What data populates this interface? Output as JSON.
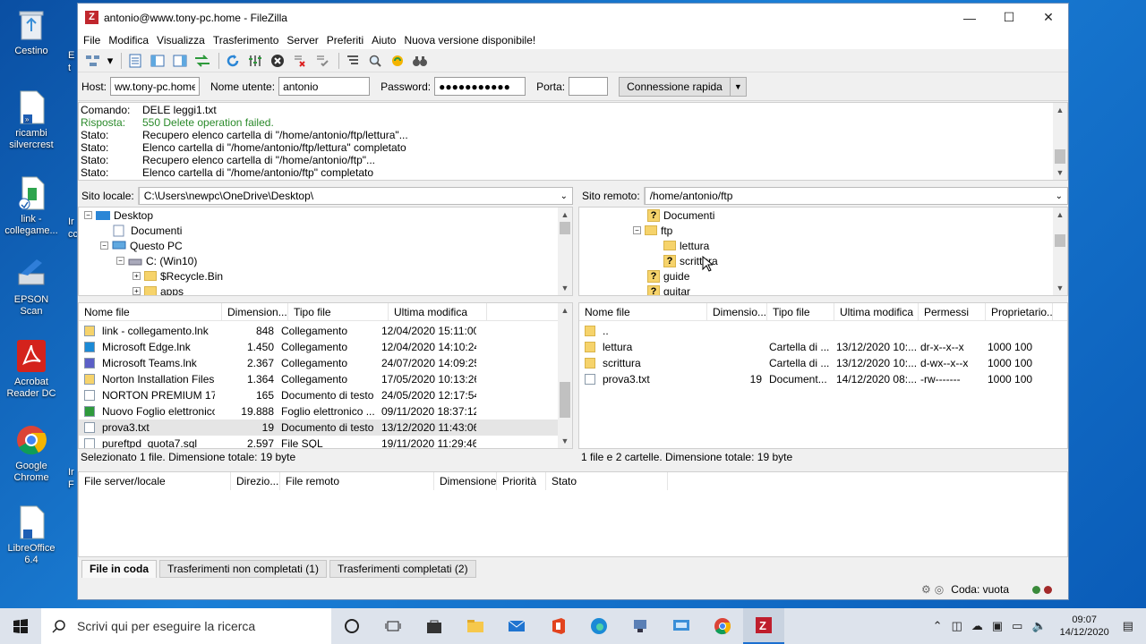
{
  "desktop": {
    "icons": [
      "Cestino",
      "ricambi silvercrest",
      "link - collegame...",
      "EPSON Scan",
      "Acrobat Reader DC",
      "Google Chrome",
      "LibreOffice 6.4"
    ],
    "partial": [
      "E",
      "t",
      "Ir",
      "cc",
      "Ir",
      "F"
    ]
  },
  "window": {
    "title": "antonio@www.tony-pc.home - FileZilla",
    "minimize": "—",
    "maximize": "☐",
    "close": "✕",
    "logo": "Z"
  },
  "menu": [
    "File",
    "Modifica",
    "Visualizza",
    "Trasferimento",
    "Server",
    "Preferiti",
    "Aiuto",
    "Nuova versione disponibile!"
  ],
  "quickconnect": {
    "host_label": "Host:",
    "host": "ww.tony-pc.home",
    "user_label": "Nome utente:",
    "user": "antonio",
    "pass_label": "Password:",
    "pass": "●●●●●●●●●●●",
    "port_label": "Porta:",
    "port": "",
    "button": "Connessione rapida"
  },
  "log": [
    {
      "k": "Comando:",
      "v": "DELE leggi1.txt",
      "color": "#000"
    },
    {
      "k": "Risposta:",
      "v": "550 Delete operation failed.",
      "color": "#2a8a2a"
    },
    {
      "k": "Stato:",
      "v": "Recupero elenco cartella di \"/home/antonio/ftp/lettura\"...",
      "color": "#000"
    },
    {
      "k": "Stato:",
      "v": "Elenco cartella di \"/home/antonio/ftp/lettura\" completato",
      "color": "#000"
    },
    {
      "k": "Stato:",
      "v": "Recupero elenco cartella di \"/home/antonio/ftp\"...",
      "color": "#000"
    },
    {
      "k": "Stato:",
      "v": "Elenco cartella di \"/home/antonio/ftp\" completato",
      "color": "#000"
    }
  ],
  "local": {
    "label": "Sito locale:",
    "path": "C:\\Users\\newpc\\OneDrive\\Desktop\\",
    "tree": [
      "Desktop",
      "Documenti",
      "Questo PC",
      "C: (Win10)",
      "$Recycle.Bin",
      "apps"
    ],
    "headers": [
      "Nome file",
      "Dimension...",
      "Tipo file",
      "Ultima modifica"
    ],
    "files": [
      {
        "n": "link - collegamento.lnk",
        "s": "848",
        "t": "Collegamento",
        "d": "12/04/2020 15:11:00"
      },
      {
        "n": "Microsoft Edge.lnk",
        "s": "1.450",
        "t": "Collegamento",
        "d": "12/04/2020 14:10:24"
      },
      {
        "n": "Microsoft Teams.lnk",
        "s": "2.367",
        "t": "Collegamento",
        "d": "24/07/2020 14:09:25"
      },
      {
        "n": "Norton Installation Files.lnk",
        "s": "1.364",
        "t": "Collegamento",
        "d": "17/05/2020 10:13:26"
      },
      {
        "n": "NORTON PREMIUM 17-05...",
        "s": "165",
        "t": "Documento di testo",
        "d": "24/05/2020 12:17:54"
      },
      {
        "n": "Nuovo Foglio elettronico ...",
        "s": "19.888",
        "t": "Foglio elettronico ...",
        "d": "09/11/2020 18:37:12"
      },
      {
        "n": "prova3.txt",
        "s": "19",
        "t": "Documento di testo",
        "d": "13/12/2020 11:43:06"
      },
      {
        "n": "pureftpd_quota7.sql",
        "s": "2.597",
        "t": "File SQL",
        "d": "19/11/2020 11:29:46"
      }
    ],
    "status": "Selezionato 1 file. Dimensione totale: 19 byte"
  },
  "remote": {
    "label": "Sito remoto:",
    "path": "/home/antonio/ftp",
    "tree": [
      "Documenti",
      "ftp",
      "lettura",
      "scrittura",
      "guide",
      "guitar"
    ],
    "headers": [
      "Nome file",
      "Dimensio...",
      "Tipo file",
      "Ultima modifica",
      "Permessi",
      "Proprietario..."
    ],
    "files": [
      {
        "n": "..",
        "s": "",
        "t": "",
        "d": "",
        "p": "",
        "o": ""
      },
      {
        "n": "lettura",
        "s": "",
        "t": "Cartella di ...",
        "d": "13/12/2020 10:...",
        "p": "dr-x--x--x",
        "o": "1000 100"
      },
      {
        "n": "scrittura",
        "s": "",
        "t": "Cartella di ...",
        "d": "13/12/2020 10:...",
        "p": "d-wx--x--x",
        "o": "1000 100"
      },
      {
        "n": "prova3.txt",
        "s": "19",
        "t": "Document...",
        "d": "14/12/2020 08:...",
        "p": "-rw-------",
        "o": "1000 100"
      }
    ],
    "status": "1 file e 2 cartelle. Dimensione totale: 19 byte"
  },
  "queue": {
    "headers": [
      "File server/locale",
      "Direzio...",
      "File remoto",
      "Dimensione",
      "Priorità",
      "Stato"
    ]
  },
  "tabs": [
    "File in coda",
    "Trasferimenti non completati (1)",
    "Trasferimenti completati (2)"
  ],
  "queue_status": "Coda: vuota",
  "taskbar": {
    "search": "Scrivi qui per eseguire la ricerca",
    "time": "09:07",
    "date": "14/12/2020"
  }
}
